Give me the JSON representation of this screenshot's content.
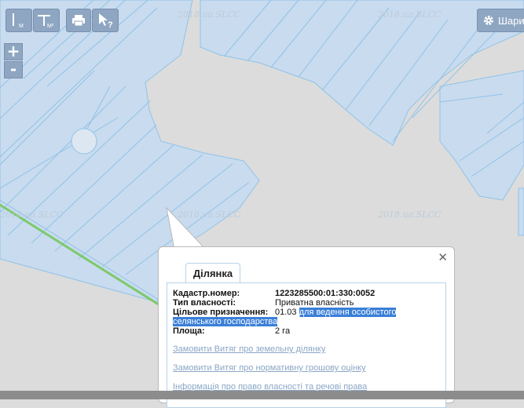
{
  "map": {
    "watermark_text": "2018.ua.SLCC",
    "land_color": "#dcdcdc",
    "parcel_fill": "#c9dbee",
    "parcel_stroke": "#8fc3e8",
    "road_color": "#7cc96a"
  },
  "toolbar": {
    "buttons": [
      {
        "name": "measure-distance",
        "sub": "М"
      },
      {
        "name": "measure-area",
        "sub": "М²"
      },
      {
        "name": "print"
      },
      {
        "name": "identify",
        "sub": "?"
      }
    ]
  },
  "zoom": {
    "in_label": "+",
    "out_label": "-"
  },
  "layers_button": {
    "label": "Шари"
  },
  "popup": {
    "close_glyph": "✕",
    "tab_label": "Ділянка",
    "fields": {
      "cadastral_label": "Кадастр.номер:",
      "cadastral_value": "1223285500:01:330:0052",
      "ownership_label": "Тип власності:",
      "ownership_value": "Приватна власність",
      "purpose_label": "Цільове призначення:",
      "purpose_code": "01.03",
      "purpose_text_1": "для ведення особистого",
      "purpose_text_2": "селянського господарства",
      "area_label": "Площа:",
      "area_value": "2 га"
    },
    "links": [
      "Замовити Витяг про земельну ділянку",
      "Замовити Витяг про нормативну грошову оцінку",
      "Інформація про право власності та речові права"
    ]
  }
}
